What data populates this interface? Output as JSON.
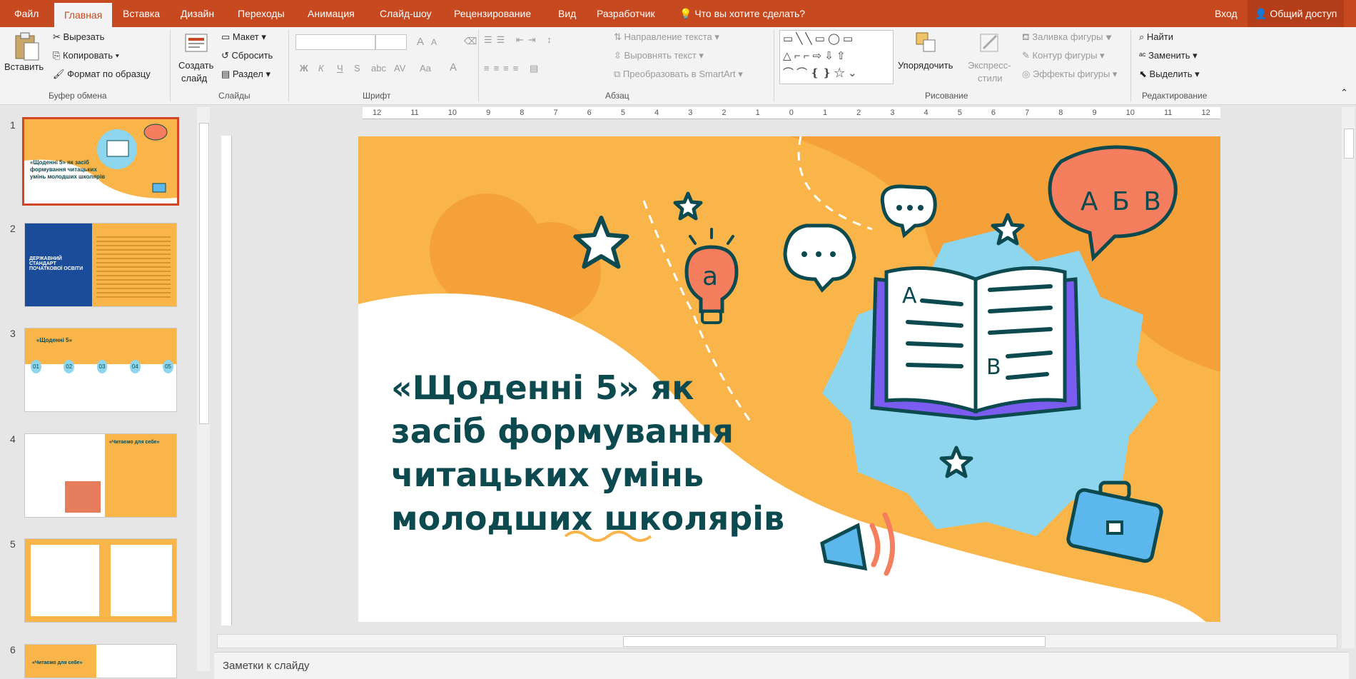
{
  "tabs": [
    "Файл",
    "Главная",
    "Вставка",
    "Дизайн",
    "Переходы",
    "Анимация",
    "Слайд-шоу",
    "Рецензирование",
    "Вид",
    "Разработчик"
  ],
  "tell_me": "Что вы хотите сделать?",
  "signin": "Вход",
  "share": "Общий доступ",
  "clipboard": {
    "paste": "Вставить",
    "cut": "Вырезать",
    "copy": "Копировать",
    "format_painter": "Формат по образцу",
    "group": "Буфер обмена"
  },
  "slides_group": {
    "new_slide_1": "Создать",
    "new_slide_2": "слайд",
    "layout": "Макет",
    "reset": "Сбросить",
    "section": "Раздел",
    "group": "Слайды"
  },
  "font_group": {
    "group": "Шрифт",
    "bold": "Ж",
    "italic": "К",
    "underline": "Ч",
    "strike": "S",
    "size_up": "A",
    "size_down": "A"
  },
  "paragraph_group": {
    "text_direction": "Направление текста",
    "align_text": "Выровнять текст",
    "smartart": "Преобразовать в SmartArt",
    "group": "Абзац"
  },
  "drawing_group": {
    "arrange": "Упорядочить",
    "quick_styles_1": "Экспресс-",
    "quick_styles_2": "стили",
    "shape_fill": "Заливка фигуры",
    "shape_outline": "Контур фигуры",
    "shape_effects": "Эффекты фигуры",
    "group": "Рисование"
  },
  "editing_group": {
    "find": "Найти",
    "replace": "Заменить",
    "select": "Выделить",
    "group": "Редактирование"
  },
  "ruler_labels": [
    "12",
    "11",
    "10",
    "9",
    "8",
    "7",
    "6",
    "5",
    "4",
    "3",
    "2",
    "1",
    "0",
    "1",
    "2",
    "3",
    "4",
    "5",
    "6",
    "7",
    "8",
    "9",
    "10",
    "11",
    "12"
  ],
  "slide_numbers": [
    "1",
    "2",
    "3",
    "4",
    "5",
    "6"
  ],
  "thumb1_text": "«Щоденні 5» як засіб формування читацьких умінь молодших школярів",
  "thumb2_text": "ДЕРЖАВНИЙ СТАНДАРТ ПОЧАТКОВОЇ ОСВІТИ",
  "thumb3_text": "«Щоденні 5»",
  "thumb3_steps": [
    "01",
    "02",
    "03",
    "04",
    "05"
  ],
  "thumb4_text": "«Читаємо для себе»",
  "thumb6_text": "«Читаємо для себе»",
  "slide": {
    "title": "«Щоденні 5» як засіб формування читацьких умінь молодших школярів",
    "bubble_text": "А Б В",
    "book_letter_a": "A",
    "book_letter_b": "B",
    "bulb_letter": "a"
  },
  "notes_placeholder": "Заметки к слайду",
  "colors": {
    "accent": "#c6491f",
    "slide_bg": "#f9b549",
    "title": "#0c4a50",
    "blob": "#8dd6ee",
    "bubble": "#f47e5e",
    "book_cover": "#7b5cf0",
    "briefcase": "#5bb7ec"
  }
}
